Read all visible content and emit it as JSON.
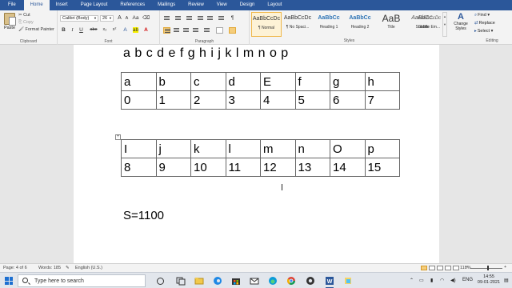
{
  "ribbon_tabs": [
    "File",
    "Home",
    "Insert",
    "Page Layout",
    "References",
    "Mailings",
    "Review",
    "View",
    "Design",
    "Layout"
  ],
  "active_tab": "Home",
  "clipboard": {
    "paste": "Paste",
    "cut": "Cut",
    "copy": "Copy",
    "format_painter": "Format Painter",
    "label": "Clipboard"
  },
  "font": {
    "name": "Calibri (Body)",
    "size": "26",
    "label": "Font",
    "bold": "B",
    "italic": "I",
    "underline": "U",
    "strike": "abe",
    "subscript": "x₂",
    "superscript": "x²",
    "case": "Aa",
    "highlight": "ab",
    "color": "A",
    "grow": "A",
    "shrink": "A"
  },
  "paragraph": {
    "label": "Paragraph",
    "pilcrow": "¶"
  },
  "styles": {
    "label": "Styles",
    "items": [
      {
        "sample": "AaBbCcDc",
        "name": "¶ Normal"
      },
      {
        "sample": "AaBbCcDc",
        "name": "¶ No Spaci..."
      },
      {
        "sample": "AaBbCc",
        "name": "Heading 1"
      },
      {
        "sample": "AaBbCc",
        "name": "Heading 2"
      },
      {
        "sample": "AaB",
        "name": "Title"
      },
      {
        "sample": "AaBbCc.",
        "name": "Subtitle"
      },
      {
        "sample": "AaBbCcDc",
        "name": "Subtle Em..."
      }
    ],
    "change_styles": "Change Styles"
  },
  "editing": {
    "label": "Editing",
    "find": "Find",
    "replace": "Replace",
    "select": "Select"
  },
  "document": {
    "alphabet_line": "a b c d e f g h i j k l m n o p",
    "table1": [
      [
        "a",
        "b",
        "c",
        "d",
        "E",
        "f",
        "g",
        "h"
      ],
      [
        "0",
        "1",
        "2",
        "3",
        "4",
        "5",
        "6",
        "7"
      ]
    ],
    "table2": [
      [
        "I",
        "j",
        "k",
        "l",
        "m",
        "n",
        "O",
        "p"
      ],
      [
        "8",
        "9",
        "10",
        "11",
        "12",
        "13",
        "14",
        "15"
      ]
    ],
    "s_line": "S=1100"
  },
  "statusbar": {
    "page": "Page: 4 of 6",
    "words": "Words: 185",
    "language": "English (U.S.)",
    "zoom": "118%",
    "zoom_level": 1.18
  },
  "taskbar": {
    "search_placeholder": "Type here to search",
    "lang": "ENG",
    "time": "14:55",
    "date": "09-01-2021"
  },
  "colors": {
    "word_blue": "#2b579a",
    "ribbon_bg": "#f3f3f3",
    "highlight": "#f7f000",
    "font_red": "#d00000"
  }
}
